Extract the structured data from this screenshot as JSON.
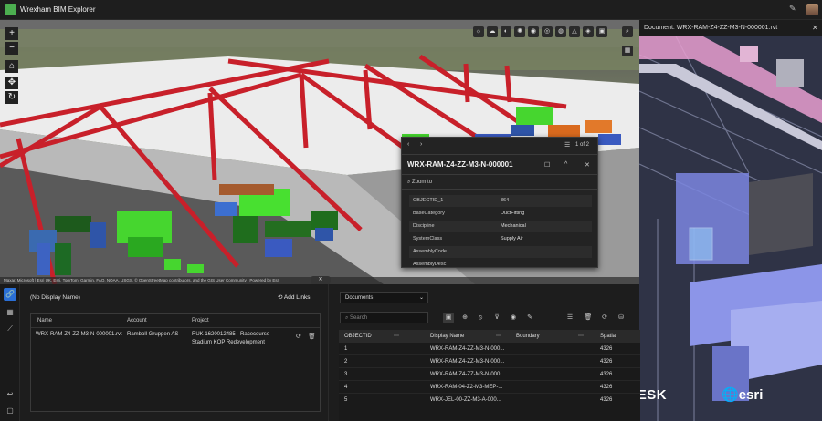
{
  "header": {
    "title": "Wrexham BIM Explorer"
  },
  "scene": {
    "attribution": "Maxar, Microsoft | Esri UK, Esri, TomTom, Garmin, FAO, NOAA, USGS, © OpenStreetMap contributors, and the GIS User Community | Powered by Esri",
    "toolbar_icons": [
      "sun-icon",
      "weather-icon",
      "daylight-icon",
      "light-icon",
      "measure-icon",
      "compass-icon",
      "area-icon",
      "slice-icon",
      "layers-icon",
      "save-icon"
    ]
  },
  "popup": {
    "page": "1 of 2",
    "title": "WRX-RAM-Z4-ZZ-M3-N-000001",
    "zoom_label": "Zoom to",
    "attributes": [
      {
        "key": "OBJECTID_1",
        "value": "364"
      },
      {
        "key": "BaseCategory",
        "value": "DuctFitting"
      },
      {
        "key": "Discipline",
        "value": "Mechanical"
      },
      {
        "key": "SystemClass",
        "value": "Supply Air"
      },
      {
        "key": "AssemblyCode",
        "value": ""
      },
      {
        "key": "AssemblyDesc",
        "value": ""
      }
    ]
  },
  "document": {
    "title": "Document: WRX-RAM-Z4-ZZ-M3-N-000001.rvt",
    "brand_left": "AUTODESK",
    "brand_right": "esri"
  },
  "links": {
    "label": "(No Display Name)",
    "add_links": "Add Links",
    "columns": [
      "Name",
      "Account",
      "Project"
    ],
    "row": {
      "name": "WRX-RAM-Z4-ZZ-M3-N-000001.rvt",
      "account": "Ramboll Gruppen AS",
      "project": "RUK 1620012485 - Racecourse Stadium KOP Redevelopment"
    }
  },
  "documents_table": {
    "selector": "Documents",
    "search_placeholder": "Search",
    "columns": [
      "OBJECTID",
      "Display Name",
      "Boundary",
      "Spatial"
    ],
    "rows": [
      {
        "id": "1",
        "name": "WRX-RAM-Z4-ZZ-M3-N-000...",
        "boundary": "",
        "spatial": "4326"
      },
      {
        "id": "2",
        "name": "WRX-RAM-Z4-ZZ-M3-N-000...",
        "boundary": "",
        "spatial": "4326"
      },
      {
        "id": "3",
        "name": "WRX-RAM-Z4-ZZ-M3-N-000...",
        "boundary": "",
        "spatial": "4326"
      },
      {
        "id": "4",
        "name": "WRX-RAM-04-Z2-M3-MEP-...",
        "boundary": "",
        "spatial": "4326"
      },
      {
        "id": "5",
        "name": "WRX-JEL-00-ZZ-M3-A-000...",
        "boundary": "",
        "spatial": "4326"
      }
    ]
  }
}
